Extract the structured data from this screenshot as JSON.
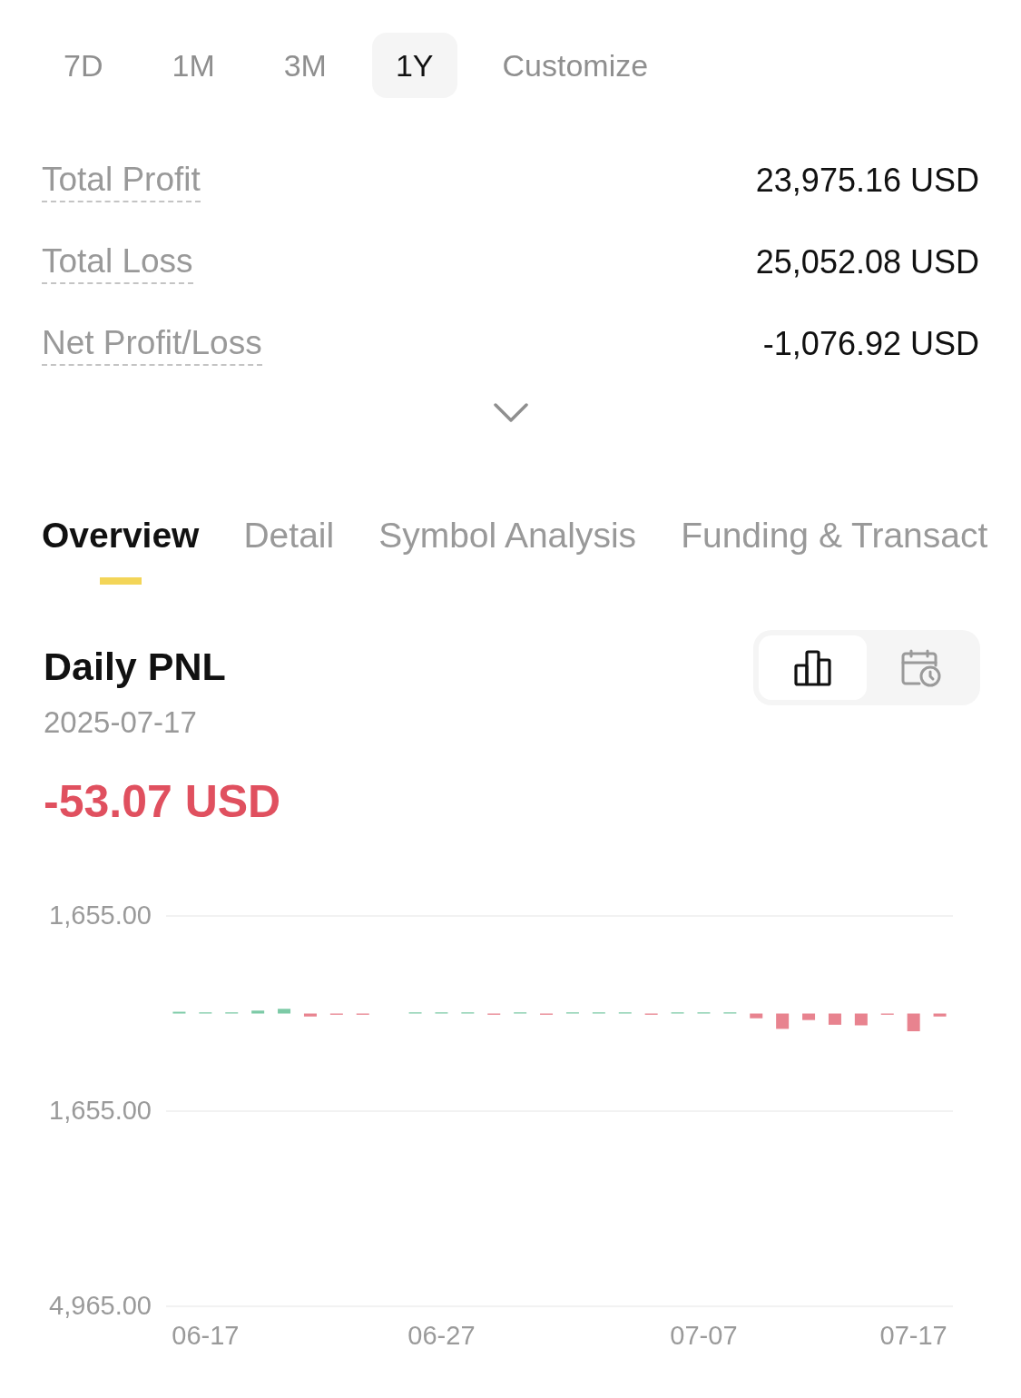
{
  "range_tabs": [
    {
      "label": "7D",
      "selected": false
    },
    {
      "label": "1M",
      "selected": false
    },
    {
      "label": "3M",
      "selected": false
    },
    {
      "label": "1Y",
      "selected": true
    },
    {
      "label": "Customize",
      "selected": false
    }
  ],
  "summary": {
    "expanded": false,
    "rows": [
      {
        "label": "Total Profit",
        "value": "23,975.16 USD"
      },
      {
        "label": "Total Loss",
        "value": "25,052.08 USD"
      },
      {
        "label": "Net Profit/Loss",
        "value": "-1,076.92 USD"
      }
    ]
  },
  "section_tabs": [
    {
      "label": "Overview",
      "selected": true
    },
    {
      "label": "Detail",
      "selected": false
    },
    {
      "label": "Symbol Analysis",
      "selected": false
    },
    {
      "label": "Funding & Transact",
      "selected": false
    }
  ],
  "daily_pnl": {
    "title": "Daily PNL",
    "date": "2025-07-17",
    "amount": "-53.07 USD",
    "kind": "loss",
    "view_toggle": [
      {
        "kind": "bar-chart",
        "selected": true
      },
      {
        "kind": "calendar",
        "selected": false
      }
    ],
    "chart_data": {
      "type": "bar",
      "categories": [
        null,
        "06-17",
        null,
        null,
        null,
        null,
        null,
        null,
        null,
        null,
        "06-27",
        null,
        null,
        null,
        null,
        null,
        null,
        null,
        null,
        null,
        "07-07",
        null,
        null,
        null,
        null,
        null,
        null,
        null,
        "07-17",
        null
      ],
      "values": [
        30,
        20,
        20,
        50,
        80,
        -50,
        -20,
        -20,
        0,
        20,
        20,
        20,
        -20,
        20,
        -20,
        20,
        20,
        20,
        -20,
        20,
        20,
        20,
        -80,
        -260,
        -110,
        -190,
        -200,
        -20,
        -300,
        -50
      ],
      "ylim": [
        -4965,
        1655
      ],
      "yticks": [
        {
          "value": 1655,
          "label": "1,655.00"
        },
        {
          "value": -1655,
          "label": "1,655.00"
        },
        {
          "value": -4965,
          "label": "4,965.00"
        }
      ]
    }
  }
}
